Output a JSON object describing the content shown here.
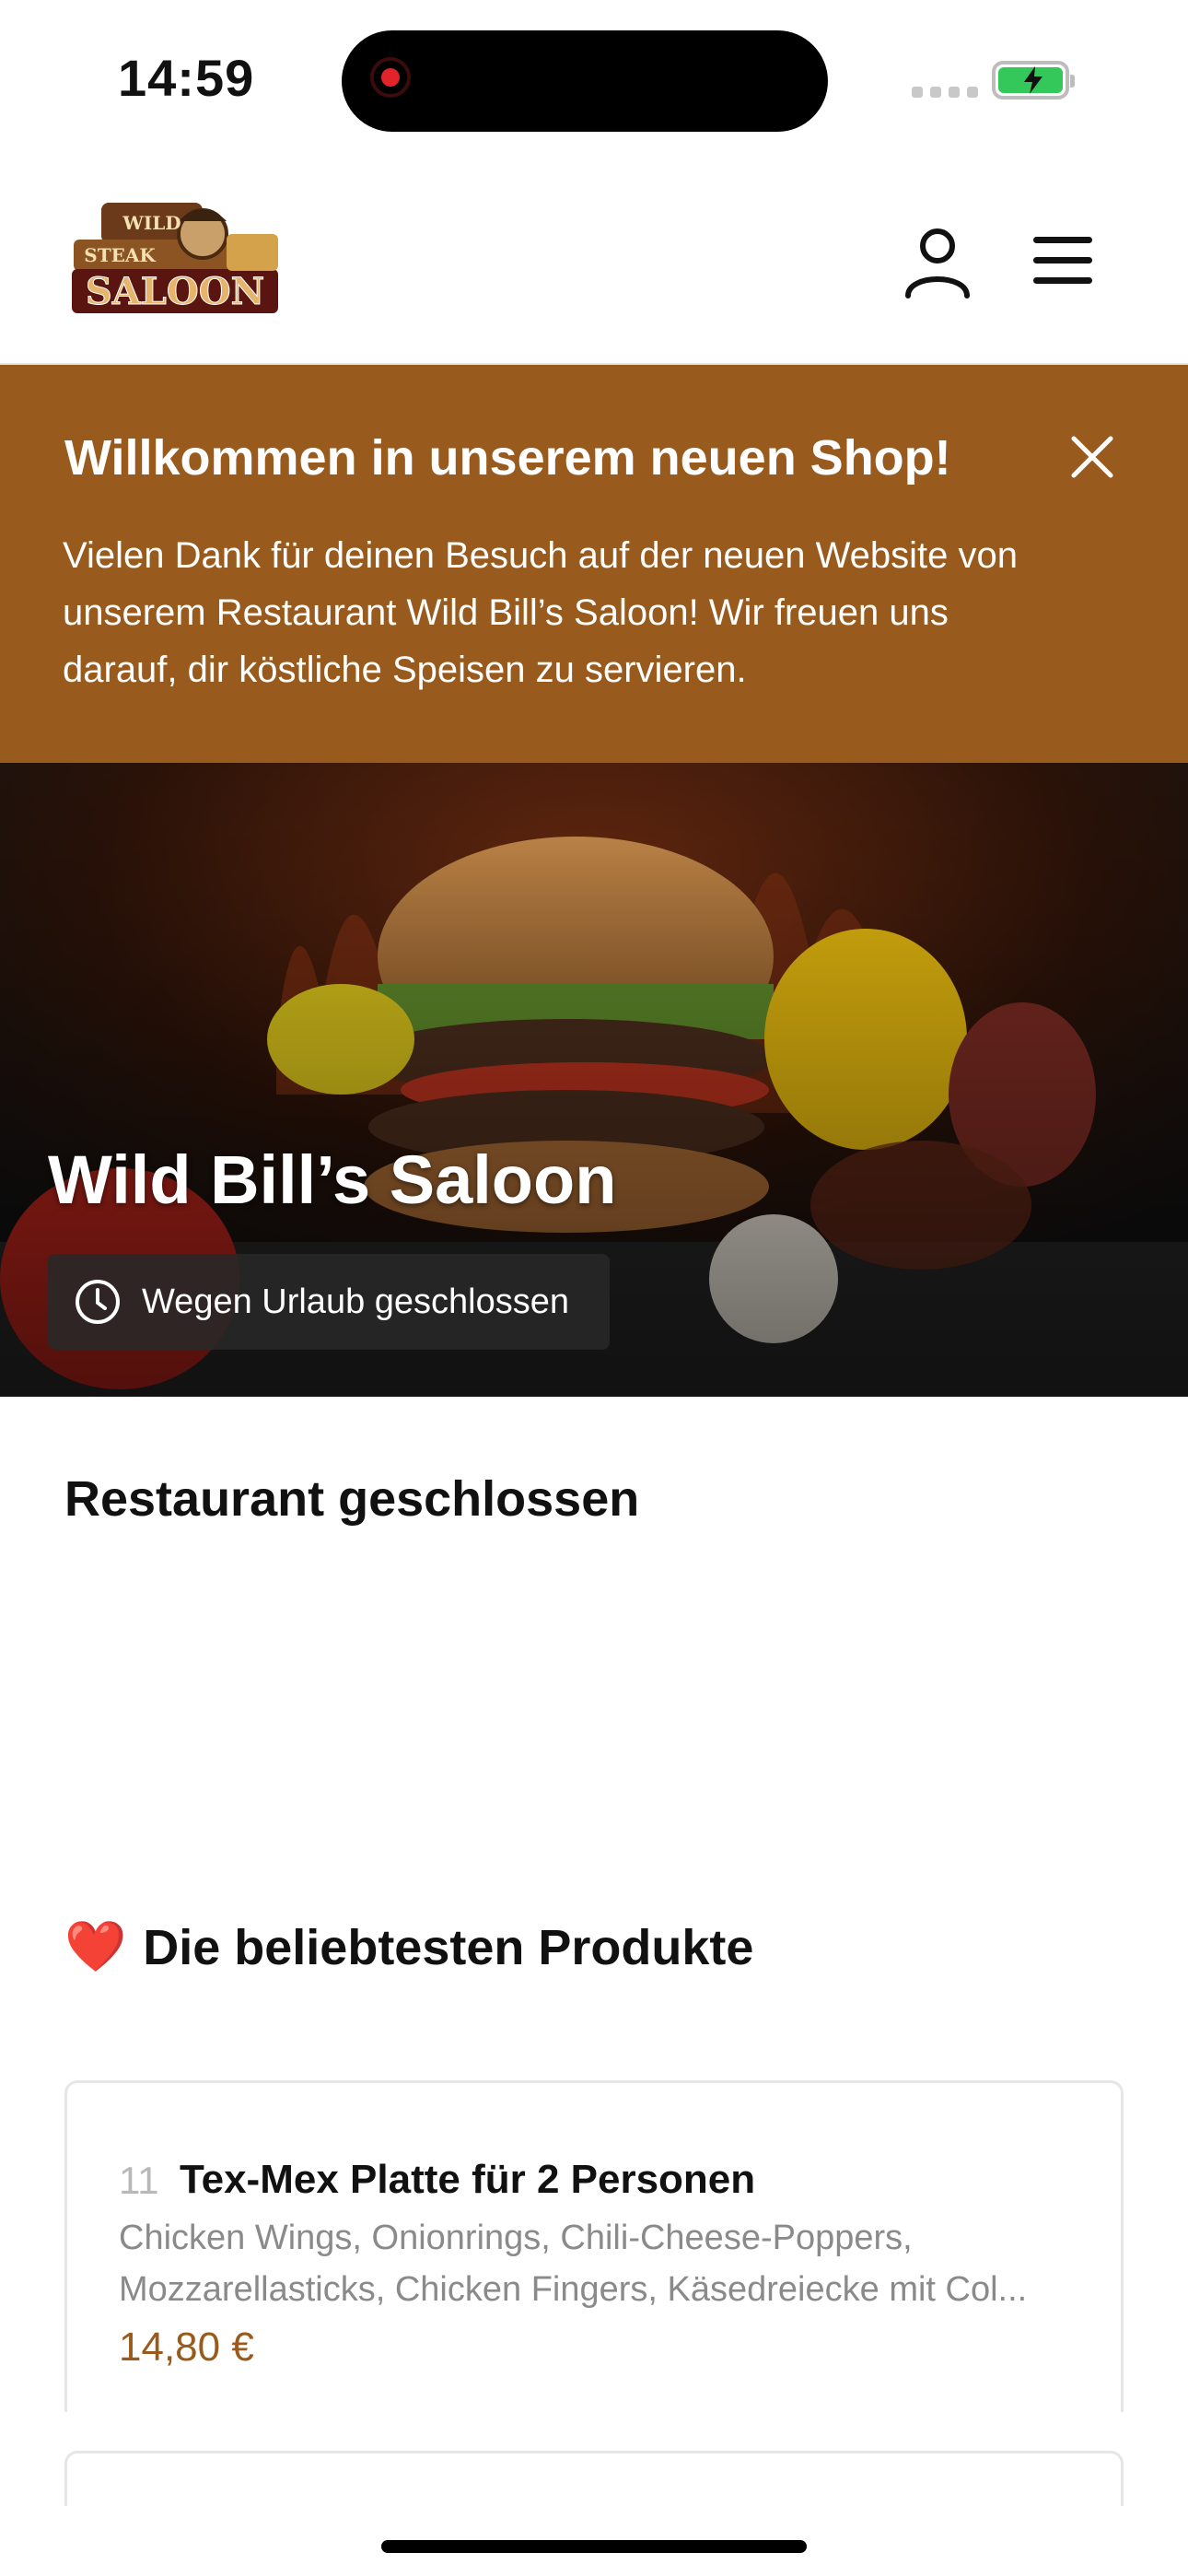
{
  "status_bar": {
    "time": "14:59"
  },
  "header": {
    "logo_name": "Wild Bill's Saloon logo"
  },
  "banner": {
    "title": "Willkommen in unserem neuen Shop!",
    "lines": [
      "Vielen Dank für deinen Besuch auf der neuen Website von",
      "unserem Restaurant Wild Bill’s Saloon! Wir freuen uns",
      "darauf, dir köstliche Speisen zu servieren."
    ]
  },
  "hero": {
    "restaurant_name": "Wild Bill’s Saloon",
    "status_text": "Wegen Urlaub geschlossen"
  },
  "closed_heading": "Restaurant geschlossen",
  "popular": {
    "emoji": "❤️",
    "heading": "Die beliebtesten Produkte",
    "products": [
      {
        "number": "11",
        "name": "Tex-Mex Platte für 2 Personen",
        "description_lines": [
          "Chicken Wings, Onionrings, Chili-Cheese-Poppers,",
          "Mozzarellasticks, Chicken Fingers, Käsedreiecke mit Col..."
        ],
        "price": "14,80 €"
      }
    ]
  },
  "colors": {
    "brand": "#985b1d",
    "battery": "#34c759",
    "record": "#e0242a"
  }
}
